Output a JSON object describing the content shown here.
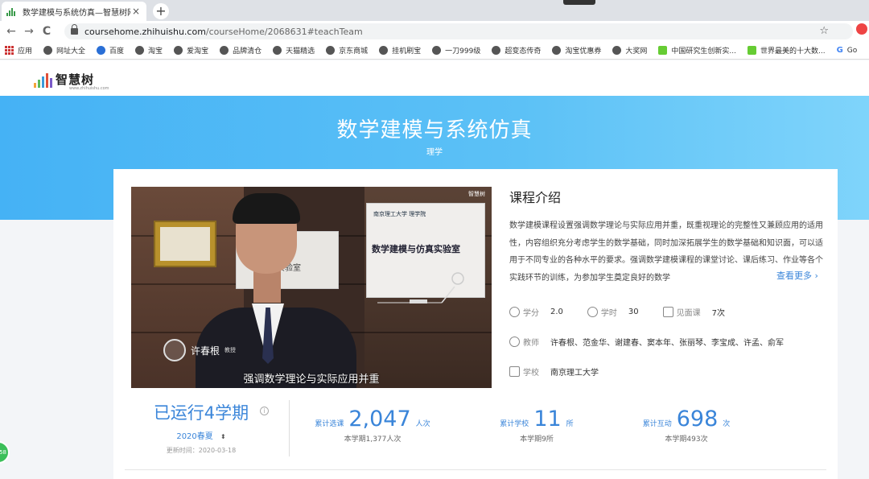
{
  "browser": {
    "tab_title": "数学建模与系统仿真—智慧树网",
    "tab_close": "×",
    "new_tab": "+",
    "url_host": "coursehome.zhihuishu.com",
    "url_path": "/courseHome/2068631#teachTeam",
    "back": "←",
    "forward": "→",
    "reload": "C",
    "star": "☆",
    "bookmarks": [
      {
        "label": "应用",
        "icon": "apps-icon"
      },
      {
        "label": "网址大全",
        "icon": "globe-icon"
      },
      {
        "label": "百度",
        "icon": "paw-icon"
      },
      {
        "label": "淘宝",
        "icon": "globe-icon"
      },
      {
        "label": "爱淘宝",
        "icon": "globe-icon"
      },
      {
        "label": "品牌清仓",
        "icon": "globe-icon"
      },
      {
        "label": "天猫精选",
        "icon": "globe-icon"
      },
      {
        "label": "京东商城",
        "icon": "globe-icon"
      },
      {
        "label": "挂机刷宝",
        "icon": "globe-icon"
      },
      {
        "label": "一刀999级",
        "icon": "globe-icon"
      },
      {
        "label": "超变态传奇",
        "icon": "globe-icon"
      },
      {
        "label": "淘宝优惠券",
        "icon": "globe-icon"
      },
      {
        "label": "大奖网",
        "icon": "globe-icon"
      },
      {
        "label": "中国研究生创新实...",
        "icon": "page-icon"
      },
      {
        "label": "世界最美的十大数...",
        "icon": "page-icon"
      },
      {
        "label": "Go",
        "icon": "google-icon"
      }
    ]
  },
  "site": {
    "logo_text": "智慧树",
    "logo_sub": "www.zhihuishu.com"
  },
  "course": {
    "title": "数学建模与系统仿真",
    "category": "理学",
    "intro_title": "课程介绍",
    "intro_text": "数学建模课程设置强调数学理论与实际应用并重，既重视理论的完整性又兼顾应用的适用性，内容组织充分考虑学生的数学基础，同时加深拓展学生的数学基础和知识面，可以适用于不同专业的各种水平的要求。强调数学建模课程的课堂讨论、课后练习、作业等各个实践环节的训练，为参加学生奠定良好的数学",
    "more": "查看更多",
    "more_arrow": "›",
    "credit_label": "学分",
    "credit_value": "2.0",
    "hours_label": "学时",
    "hours_value": "30",
    "meet_label": "见面课",
    "meet_value": "7次",
    "teacher_label": "教师",
    "teachers": "许春根、范金华、谢建春、窦本年、张丽琴、李宝成、许孟、俞军",
    "school_label": "学校",
    "school": "南京理工大学"
  },
  "video": {
    "brand": "智慧树",
    "lecturer_name": "许春根",
    "lecturer_title": "教授",
    "subtitle": "强调数学理论与实际应用并重",
    "sign_lab1": "统计实验室",
    "sign_school": "南京理工大学 理学院",
    "sign_lab2": "数学建模与仿真实验室"
  },
  "stats": {
    "run_label": "已运行4学期",
    "info_icon": "i",
    "semester": "2020春夏",
    "semester_arrows": "⬍",
    "update_time": "更新时间：2020-03-18",
    "items": [
      {
        "label": "累计选课",
        "value": "2,047",
        "unit": "人次",
        "sub": "本学期1,377人次"
      },
      {
        "label": "累计学校",
        "value": "11",
        "unit": "所",
        "sub": "本学期9所"
      },
      {
        "label": "累计互动",
        "value": "698",
        "unit": "次",
        "sub": "本学期493次"
      }
    ]
  },
  "float_button": "58",
  "colors": {
    "accent": "#3a85d9",
    "banner": "#4fb8f5"
  }
}
